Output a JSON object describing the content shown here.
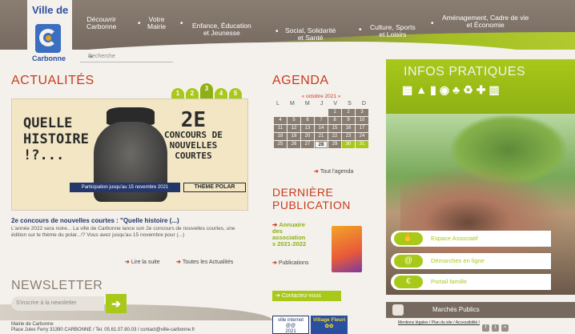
{
  "logo": {
    "ville_de": "Ville de",
    "name": "Carbonne"
  },
  "nav": [
    {
      "label": "Découvrir\nCarbonne"
    },
    {
      "label": "Votre\nMairie"
    },
    {
      "label": "Enfance, Éducation\net Jeunesse"
    },
    {
      "label": "Social, Solidarité\net Santé"
    },
    {
      "label": "Culture, Sports\net Loisirs"
    },
    {
      "label": "Aménagement, Cadre de vie\net Économie"
    }
  ],
  "search": {
    "placeholder": "Recherche"
  },
  "actualites": {
    "title": "ACTUALITÉS",
    "pages": [
      "1",
      "2",
      "3",
      "4",
      "5"
    ],
    "hero": {
      "left_text": "QUELLE\nHISTOIRE\n!?...",
      "right_big": "2E",
      "right_lines": "CONCOURS DE\nNOUVELLES\nCOURTES",
      "banner": "Participation jusqu'au 15 novembre 2021",
      "polar": "THÈME POLAR"
    },
    "news_title": "2e concours de nouvelles courtes : \"Quelle histoire (...)",
    "news_text": "L'année 2022 sera noire... La ville de Carbonne lance son 2e concours de nouvelles courtes, une édition sur le thème du polar...!? Vous avez jusqu'au 15 novembre pour (...)",
    "read_more": "Lire la suite",
    "all_news": "Toutes les Actualités"
  },
  "agenda": {
    "title": "AGENDA",
    "month": "« octobre 2021 »",
    "dows": [
      "L",
      "M",
      "M",
      "J",
      "V",
      "S",
      "D"
    ],
    "cells": [
      "",
      "",
      "",
      "",
      "1",
      "2",
      "3",
      "4",
      "5",
      "6",
      "7",
      "8",
      "9",
      "10",
      "11",
      "12",
      "13",
      "14",
      "15",
      "16",
      "17",
      "18",
      "19",
      "20",
      "21",
      "22",
      "23",
      "24",
      "25",
      "26",
      "27",
      "28",
      "29",
      "30",
      "31"
    ],
    "all": "Tout l'agenda"
  },
  "publication": {
    "title": "DERNIÈRE\nPUBLICATION",
    "item": "Annuaire\ndes\nassociation\ns 2021-2022",
    "publications": "Publications"
  },
  "contact": "Contactez-nous",
  "badges": {
    "internet": "ville internet\n@@\n2021",
    "fleuri": "Village Fleuri\n✿✿"
  },
  "infos": {
    "title": "INFOS PRATIQUES",
    "icons": [
      "map-icon",
      "traffic-cone-icon",
      "book-icon",
      "car-icon",
      "people-icon",
      "recycle-icon",
      "cross-icon",
      "bin-icon"
    ]
  },
  "quick_links": [
    {
      "label": "Espace Associatif",
      "icon": "handshake-icon"
    },
    {
      "label": "Démarches en ligne",
      "icon": "at-icon"
    },
    {
      "label": "Portail famille",
      "icon": "euro-icon"
    }
  ],
  "marches": "Marchés Publics",
  "footer": {
    "links": "Mentions légales / Plan du site / Accessibilité /"
  },
  "newsletter": {
    "title": "NEWSLETTER",
    "placeholder": "S'inscrire à la newsletter"
  },
  "address": {
    "line1": "Mairie de Carbonne",
    "line2": "Place Jules Ferry 31390 CARBONNE / Tel. 05.61.07.80.03 / contact@ville-carbonne.fr"
  }
}
